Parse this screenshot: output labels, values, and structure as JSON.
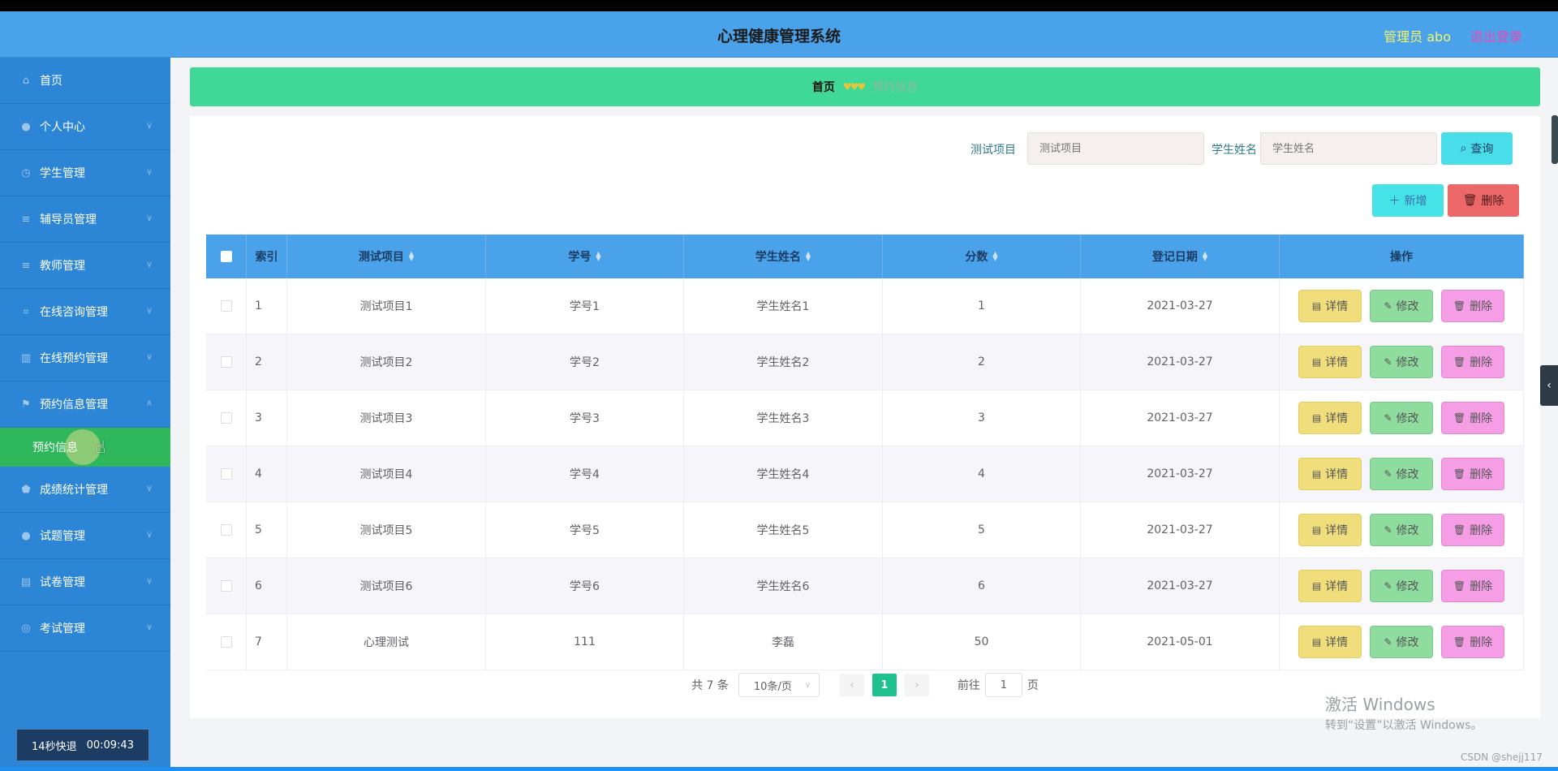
{
  "header": {
    "title": "心理健康管理系统",
    "admin": "管理员 abo",
    "logout": "退出登录"
  },
  "sidebar": {
    "items": [
      {
        "label": "首页",
        "icon": "home-icon",
        "chevron": false
      },
      {
        "label": "个人中心",
        "icon": "user-icon",
        "chevron": true
      },
      {
        "label": "学生管理",
        "icon": "clock-icon",
        "chevron": true
      },
      {
        "label": "辅导员管理",
        "icon": "list-icon",
        "chevron": true
      },
      {
        "label": "教师管理",
        "icon": "list-icon",
        "chevron": true
      },
      {
        "label": "在线咨询管理",
        "icon": "crop-icon",
        "chevron": true
      },
      {
        "label": "在线预约管理",
        "icon": "building-icon",
        "chevron": true
      },
      {
        "label": "预约信息管理",
        "icon": "flag-icon",
        "chevron": true,
        "open": true
      }
    ],
    "submenu": {
      "label": "预约信息"
    },
    "items_after": [
      {
        "label": "成绩统计管理",
        "icon": "shield-icon",
        "chevron": true
      },
      {
        "label": "试题管理",
        "icon": "user-icon",
        "chevron": true
      },
      {
        "label": "试卷管理",
        "icon": "printer-icon",
        "chevron": true
      },
      {
        "label": "考试管理",
        "icon": "target-icon",
        "chevron": true
      }
    ],
    "timer": {
      "left": "14秒快退",
      "right": "00:09:43"
    }
  },
  "breadcrumb": {
    "home": "首页",
    "separator": "♥♥♥",
    "current": "预约信息"
  },
  "search": {
    "project_label": "测试项目",
    "project_placeholder": "测试项目",
    "name_label": "学生姓名",
    "name_placeholder": "学生姓名",
    "query_label": "查询"
  },
  "actions": {
    "add_label": "新增",
    "delete_label": "删除"
  },
  "table": {
    "headers": [
      "索引",
      "测试项目",
      "学号",
      "学生姓名",
      "分数",
      "登记日期",
      "操作"
    ],
    "rows": [
      [
        "1",
        "测试项目1",
        "学号1",
        "学生姓名1",
        "1",
        "2021-03-27"
      ],
      [
        "2",
        "测试项目2",
        "学号2",
        "学生姓名2",
        "2",
        "2021-03-27"
      ],
      [
        "3",
        "测试项目3",
        "学号3",
        "学生姓名3",
        "3",
        "2021-03-27"
      ],
      [
        "4",
        "测试项目4",
        "学号4",
        "学生姓名4",
        "4",
        "2021-03-27"
      ],
      [
        "5",
        "测试项目5",
        "学号5",
        "学生姓名5",
        "5",
        "2021-03-27"
      ],
      [
        "6",
        "测试项目6",
        "学号6",
        "学生姓名6",
        "6",
        "2021-03-27"
      ],
      [
        "7",
        "心理测试",
        "111",
        "李磊",
        "50",
        "2021-05-01"
      ]
    ],
    "row_actions": {
      "detail": "详情",
      "edit": "修改",
      "delete": "删除"
    }
  },
  "pager": {
    "total": "共 7 条",
    "page_size": "10条/页",
    "current_page": "1",
    "goto_prefix": "前往",
    "goto_value": "1",
    "goto_suffix": "页"
  },
  "watermark": {
    "line1": "激活 Windows",
    "line2": "转到“设置”以激活 Windows。",
    "credit": "CSDN @shejj117"
  },
  "colors": {
    "header": "#4aa3ea",
    "sidebar": "#2d86d5",
    "breadcrumb": "#3fd896",
    "active_submenu": "#2fb75c",
    "pager_active": "#1fc18f"
  }
}
